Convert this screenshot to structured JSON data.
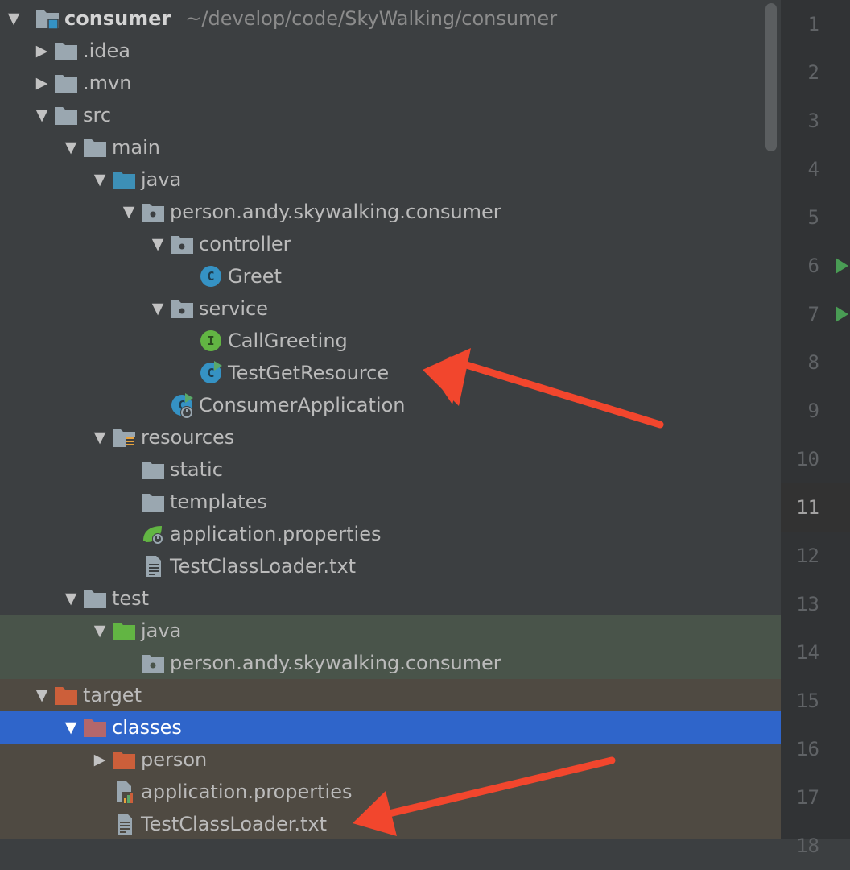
{
  "project_tree": {
    "root": {
      "label": "consumer",
      "path": "~/develop/code/SkyWalking/consumer"
    },
    "items": [
      {
        "label": ".idea",
        "icon": "folder-icon"
      },
      {
        "label": ".mvn",
        "icon": "folder-icon"
      },
      {
        "label": "src",
        "icon": "folder-icon"
      },
      {
        "label": "main",
        "icon": "folder-icon"
      },
      {
        "label": "java",
        "icon": "source-root-folder-icon"
      },
      {
        "label": "person.andy.skywalking.consumer",
        "icon": "package-icon"
      },
      {
        "label": "controller",
        "icon": "package-icon"
      },
      {
        "label": "Greet",
        "icon": "class-icon",
        "badge": "C"
      },
      {
        "label": "service",
        "icon": "package-icon"
      },
      {
        "label": "CallGreeting",
        "icon": "interface-icon",
        "badge": "I"
      },
      {
        "label": "TestGetResource",
        "icon": "runnable-class-icon",
        "badge": "C"
      },
      {
        "label": "ConsumerApplication",
        "icon": "spring-boot-class-icon",
        "badge": "C"
      },
      {
        "label": "resources",
        "icon": "resources-root-folder-icon"
      },
      {
        "label": "static",
        "icon": "folder-icon"
      },
      {
        "label": "templates",
        "icon": "folder-icon"
      },
      {
        "label": "application.properties",
        "icon": "spring-properties-icon"
      },
      {
        "label": "TestClassLoader.txt",
        "icon": "text-file-icon"
      },
      {
        "label": "test",
        "icon": "folder-icon"
      },
      {
        "label": "java",
        "icon": "test-root-folder-icon"
      },
      {
        "label": "person.andy.skywalking.consumer",
        "icon": "package-icon"
      },
      {
        "label": "target",
        "icon": "excluded-folder-icon"
      },
      {
        "label": "classes",
        "icon": "excluded-folder-icon",
        "selected": true
      },
      {
        "label": "person",
        "icon": "excluded-folder-icon"
      },
      {
        "label": "application.properties",
        "icon": "properties-file-icon"
      },
      {
        "label": "TestClassLoader.txt",
        "icon": "text-file-icon"
      }
    ]
  },
  "gutter": {
    "line_numbers": [
      "1",
      "2",
      "3",
      "4",
      "5",
      "6",
      "7",
      "8",
      "9",
      "10",
      "11",
      "12",
      "13",
      "14",
      "15",
      "16",
      "17",
      "18"
    ],
    "current_line": "11",
    "run_markers_on_lines": [
      "6",
      "7"
    ]
  },
  "colors": {
    "panel_bg": "#3c3f41",
    "selection": "#2f65ca",
    "test_bg": "#49544a",
    "excluded_bg": "#4f4a42",
    "annotation_arrow": "#f2462d",
    "run_marker": "#499c54"
  }
}
